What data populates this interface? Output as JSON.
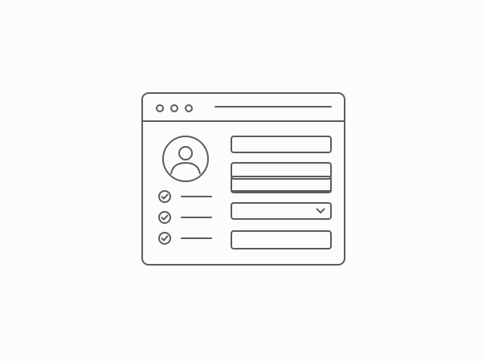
{
  "window": {
    "title": ""
  },
  "sidebar": {
    "checklist": [
      {
        "label": "",
        "checked": true
      },
      {
        "label": "",
        "checked": true
      },
      {
        "label": "",
        "checked": true
      }
    ]
  },
  "form": {
    "field_1": {
      "value": "",
      "placeholder": ""
    },
    "field_2": {
      "value": "",
      "placeholder": ""
    },
    "field_3": {
      "value": "",
      "placeholder": ""
    },
    "select": {
      "selected": ""
    },
    "field_5": {
      "value": "",
      "placeholder": ""
    }
  },
  "icons": {
    "avatar": "user-avatar-icon",
    "check": "check-circle-icon",
    "chevron": "chevron-down-icon"
  },
  "colors": {
    "stroke": "#5c5c5c",
    "background": "#fcfcfc"
  }
}
